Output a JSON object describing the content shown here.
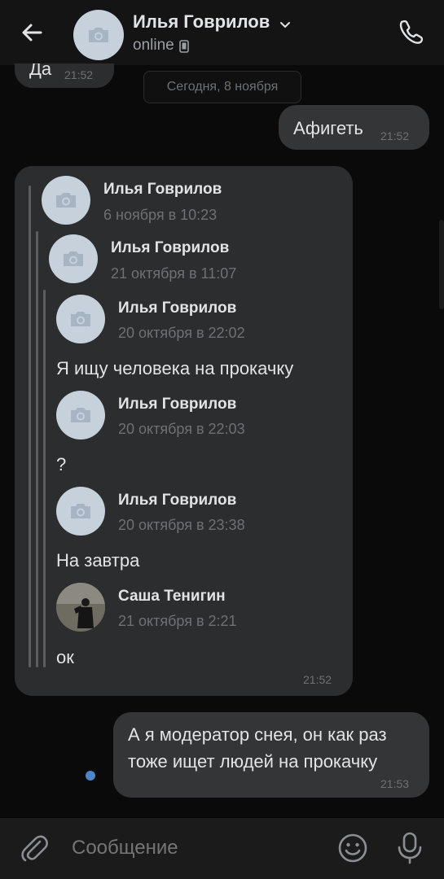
{
  "header": {
    "contact_name": "Илья Говрилов",
    "status": "online"
  },
  "messages": {
    "prev_in": {
      "text": "Да",
      "time": "21:52"
    },
    "date_separator": "Сегодня, 8 ноября",
    "out1": {
      "text": "Афигеть",
      "time": "21:52"
    },
    "forwarded": {
      "time": "21:52",
      "items": [
        {
          "name": "Илья Говрилов",
          "date": "6 ноября в 10:23"
        },
        {
          "name": "Илья Говрилов",
          "date": "21 октября в 11:07"
        },
        {
          "name": "Илья Говрилов",
          "date": "20 октября в 22:02",
          "text": "Я ищу человека на прокачку"
        },
        {
          "name": "Илья Говрилов",
          "date": "20 октября в 22:03",
          "text": "?"
        },
        {
          "name": "Илья Говрилов",
          "date": "20 октября в 23:38",
          "text": "На завтра"
        },
        {
          "name": "Саша Тенигин",
          "date": "21 октября в 2:21",
          "text": "ок"
        }
      ]
    },
    "out2": {
      "line1": "А я модератор снея, он как раз",
      "line2": "тоже ищет людей на прокачку",
      "time": "21:53"
    }
  },
  "composer": {
    "placeholder": "Сообщение"
  },
  "colors": {
    "accent_dot": "#4a86c8",
    "bubble": "#2c2d2f",
    "background": "#0a0a0a"
  }
}
